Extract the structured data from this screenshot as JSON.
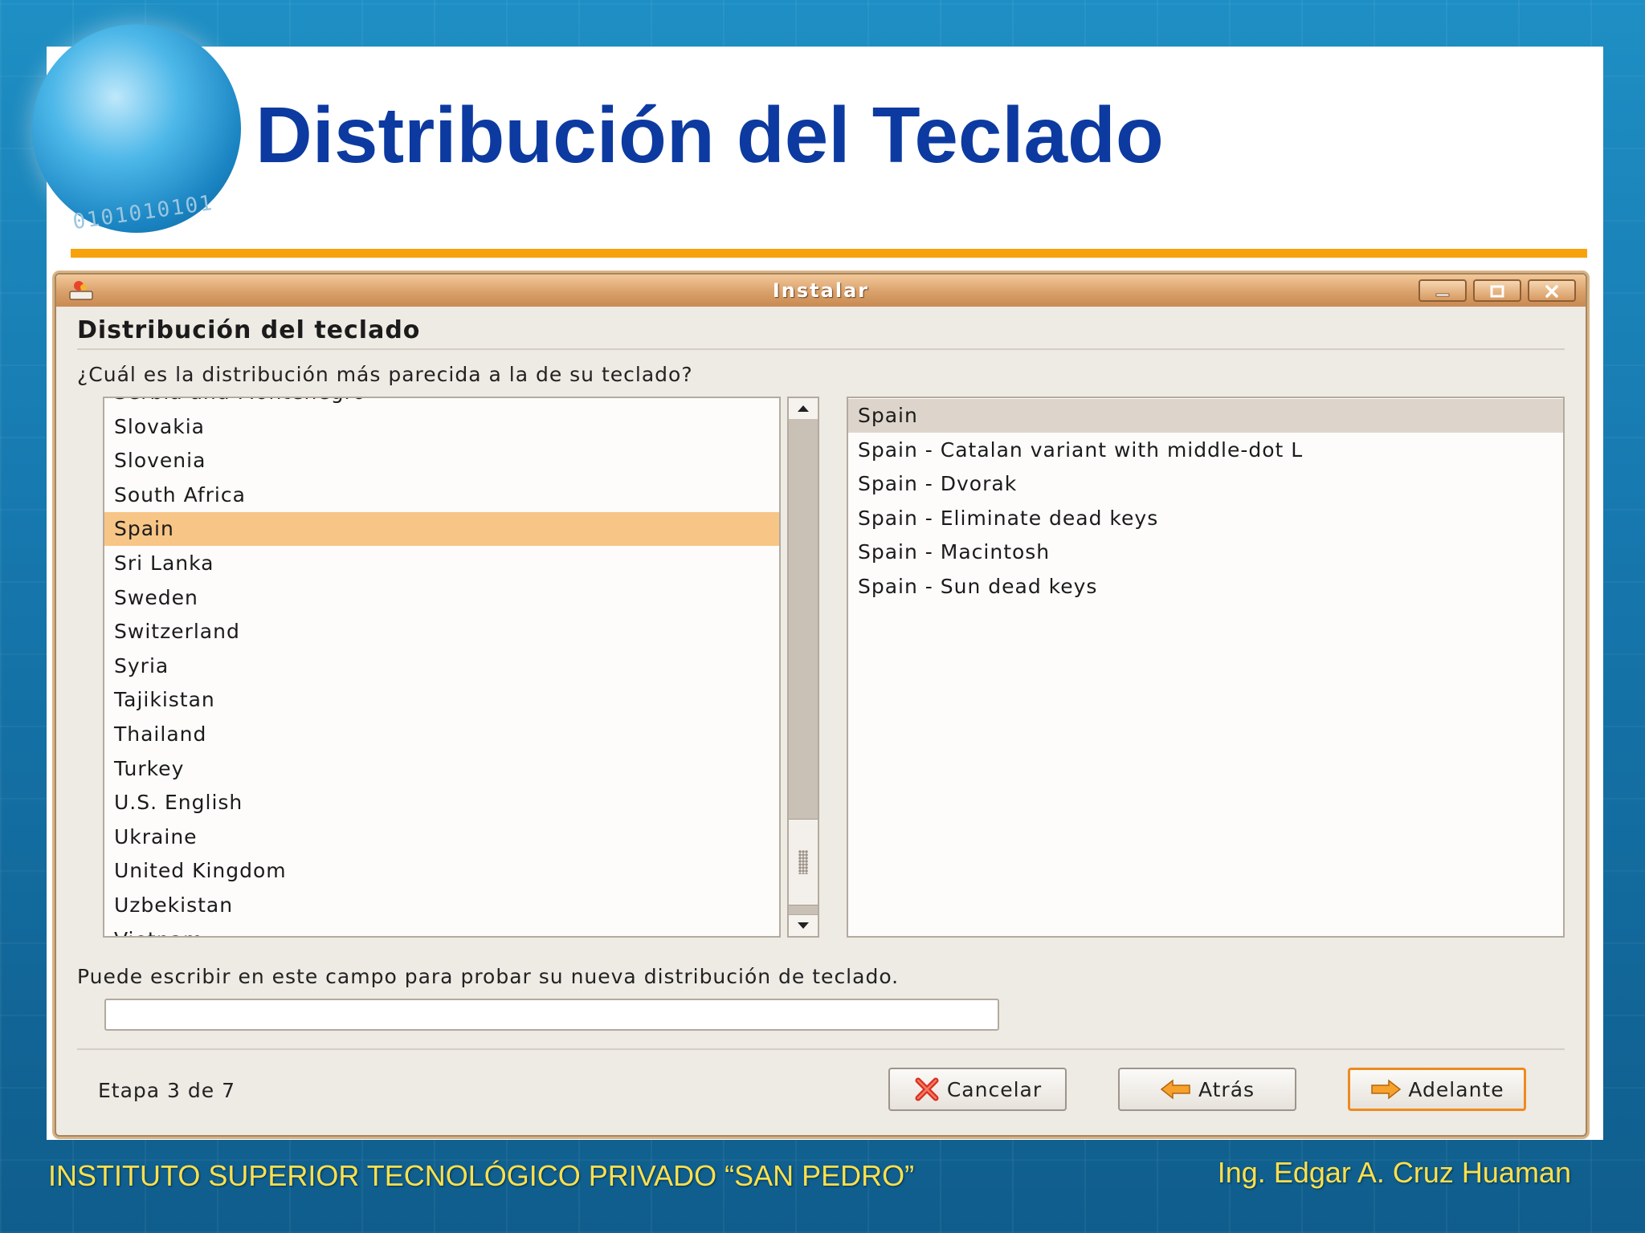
{
  "slide": {
    "title": "Distribución del Teclado",
    "footer_left": "INSTITUTO SUPERIOR TECNOLÓGICO PRIVADO “SAN PEDRO”",
    "footer_right": "Ing. Edgar A. Cruz Huaman",
    "accent_color": "#f7a20a",
    "title_color": "#0c3aa0"
  },
  "window": {
    "title": "Instalar",
    "icon": "installer-icon",
    "controls": [
      "minimize-icon",
      "maximize-icon",
      "close-icon"
    ]
  },
  "dialog": {
    "heading": "Distribución del teclado",
    "question": "¿Cuál es la distribución más parecida a la de su teclado?",
    "countries": [
      "Serbia and Montenegro",
      "Slovakia",
      "Slovenia",
      "South Africa",
      "Spain",
      "Sri Lanka",
      "Sweden",
      "Switzerland",
      "Syria",
      "Tajikistan",
      "Thailand",
      "Turkey",
      "U.S. English",
      "Ukraine",
      "United Kingdom",
      "Uzbekistan",
      "Vietnam"
    ],
    "selected_country": "Spain",
    "variants": [
      "Spain",
      "Spain - Catalan variant with middle-dot L",
      "Spain - Dvorak",
      "Spain - Eliminate dead keys",
      "Spain - Macintosh",
      "Spain - Sun dead keys"
    ],
    "selected_variant": "Spain",
    "test_hint": "Puede escribir en este campo para probar su nueva distribución de teclado.",
    "test_value": "",
    "step": "Etapa 3 de 7",
    "buttons": {
      "cancel": "Cancelar",
      "back": "Atrás",
      "next": "Adelante"
    },
    "selection_color": "#f7c586"
  }
}
